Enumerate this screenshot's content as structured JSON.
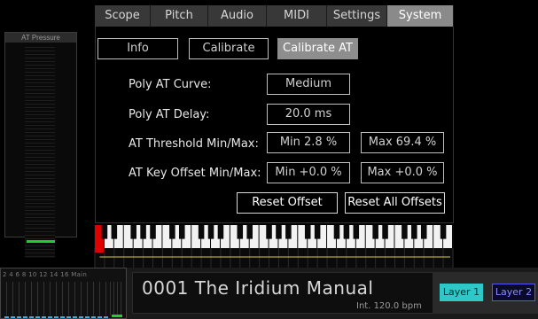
{
  "at_panel": {
    "title": "AT Pressure",
    "level_fraction": 0.07
  },
  "tabs": [
    {
      "label": "Scope",
      "active": false
    },
    {
      "label": "Pitch",
      "active": false
    },
    {
      "label": "Audio",
      "active": false
    },
    {
      "label": "MIDI",
      "active": false
    },
    {
      "label": "Settings",
      "active": false
    },
    {
      "label": "System",
      "active": true
    }
  ],
  "subtabs": {
    "info": "Info",
    "calibrate": "Calibrate",
    "calibrate_at": "Calibrate AT"
  },
  "settings": {
    "poly_at_curve": {
      "label": "Poly AT Curve:",
      "value": "Medium"
    },
    "poly_at_delay": {
      "label": "Poly AT Delay:",
      "value": "20.0 ms"
    },
    "at_threshold": {
      "label": "AT Threshold Min/Max:",
      "min": "Min 2.8 %",
      "max": "Max 69.4 %"
    },
    "at_key_offset": {
      "label": "AT Key Offset Min/Max:",
      "min": "Min +0.0 %",
      "max": "Max +0.0 %"
    }
  },
  "actions": {
    "reset_offset": "Reset Offset",
    "reset_all_offsets": "Reset All Offsets"
  },
  "keyboard": {
    "white_keys": 37,
    "highlighted_key": "first",
    "highlight_color": "#e00000",
    "line_color": "#d8d040"
  },
  "mixer": {
    "channel_labels": "2 4 6 8 10 12 14 16 Main"
  },
  "preset": {
    "name": "0001 The Iridium Manual",
    "tempo": "Int. 120.0 bpm"
  },
  "layers": [
    {
      "label": "Layer 1",
      "active": true
    },
    {
      "label": "Layer 2",
      "active": false
    }
  ]
}
